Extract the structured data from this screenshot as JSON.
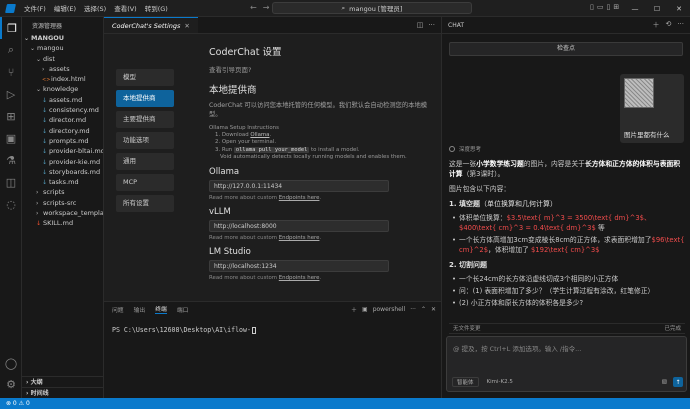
{
  "titlebar": {
    "menu": [
      "文件(F)",
      "编辑(E)",
      "选择(S)",
      "查看(V)",
      "转到(G)"
    ],
    "search_text": "mangou [管理员]"
  },
  "explorer": {
    "header": "资源管理器",
    "root": "MANGOU",
    "items": [
      {
        "label": "mangou",
        "kind": "folder",
        "indent": 1
      },
      {
        "label": "dist",
        "kind": "folder",
        "indent": 2
      },
      {
        "label": "assets",
        "kind": "folder-closed",
        "indent": 3
      },
      {
        "label": "index.html",
        "kind": "html",
        "indent": 3
      },
      {
        "label": "knowledge",
        "kind": "folder",
        "indent": 2
      },
      {
        "label": "assets.md",
        "kind": "md",
        "indent": 3
      },
      {
        "label": "consistency.md",
        "kind": "md",
        "indent": 3
      },
      {
        "label": "director.md",
        "kind": "md",
        "indent": 3
      },
      {
        "label": "directory.md",
        "kind": "md",
        "indent": 3
      },
      {
        "label": "prompts.md",
        "kind": "md",
        "indent": 3
      },
      {
        "label": "provider-bltai.md",
        "kind": "md",
        "indent": 3
      },
      {
        "label": "provider-kie.md",
        "kind": "md",
        "indent": 3
      },
      {
        "label": "storyboards.md",
        "kind": "md",
        "indent": 3
      },
      {
        "label": "tasks.md",
        "kind": "md",
        "indent": 3
      },
      {
        "label": "scripts",
        "kind": "folder-closed",
        "indent": 2
      },
      {
        "label": "scripts-src",
        "kind": "folder-closed",
        "indent": 2
      },
      {
        "label": "workspace_template",
        "kind": "folder-closed",
        "indent": 2
      },
      {
        "label": "SKILL.md",
        "kind": "skill",
        "indent": 2
      }
    ],
    "outline": "大纲",
    "timeline": "时间线"
  },
  "editor": {
    "tab_label": "CoderChat's Settings",
    "nav": [
      "模型",
      "本地提供商",
      "主要提供商",
      "功能选项",
      "通用",
      "MCP",
      "所有设置"
    ],
    "title": "CoderChat 设置",
    "guide_link": "查看引导页面?",
    "section_title": "本地提供商",
    "section_desc": "CoderChat 可以访问您本地托管的任何模型。我们默认会自动检测您的本地模型。",
    "ollama_instructions": {
      "title": "Ollama Setup Instructions",
      "step1_prefix": "1. Download ",
      "step1_link": "Ollama",
      "step1_suffix": ".",
      "step2": "2. Open your terminal.",
      "step3_prefix": "3. Run ",
      "step3_code": "ollama pull your_model",
      "step3_suffix": " to install a model.",
      "note": "Void automatically detects locally running models and enables them."
    },
    "providers": [
      {
        "name": "Ollama",
        "endpoint": "http://127.0.0.1:11434"
      },
      {
        "name": "vLLM",
        "endpoint": "http://localhost:8000"
      },
      {
        "name": "LM Studio",
        "endpoint": "http://localhost:1234"
      }
    ],
    "more_prefix": "Read more about custom ",
    "more_link": "Endpoints here",
    "more_suffix": "."
  },
  "panel": {
    "tabs": [
      "问题",
      "输出",
      "终端",
      "端口"
    ],
    "active_tab": "终端",
    "shell": "powershell",
    "prompt": "PS C:\\Users\\12608\\Desktop\\AI\\iflow-"
  },
  "chat": {
    "header": "CHAT",
    "checkpoint": "检查点",
    "user_message": "图片里都有什么",
    "assistant_head": "深度思考",
    "intro_prefix": "这是一张",
    "intro_bold1": "小学数学练习题",
    "intro_mid": "的图片，内容是关于",
    "intro_bold2": "长方体和正方体的体积与表面积计算",
    "intro_suffix": "（第3课时）。",
    "contains": "图片包含以下内容：",
    "section1_title": "1. 填空题",
    "section1_sub": "（单位换算和几何计算）",
    "s1_item1_prefix": "体积单位换算：",
    "s1_item1_red": "$3.5\\text{ m}^3 = 3500\\text{ dm}^3$、$400\\text{ cm}^3 = 0.4\\text{ dm}^3$",
    "s1_item1_suffix": " 等",
    "s1_item2_prefix": "一个长方体高增加3cm变成棱长8cm的正方体，求表面积增加了",
    "s1_item2_red1": "$96\\text{ cm}^2$",
    "s1_item2_mid": "，体积增加了 ",
    "s1_item2_red2": "$192\\text{ cm}^3$",
    "section2_title": "2. 切割问题",
    "s2_item1": "一个长24cm的长方体沿虚线切成3个相同的小正方体",
    "s2_item2": "问：(1) 表面积增加了多少？（学生计算过程有涂改，红笔修正）",
    "s2_item3": "(2) 小正方体和原长方体的体积各是多少?",
    "pending": "无文件变更",
    "pending_right": "已完成",
    "input_placeholder": "@ 提及，按 Ctrl+L 添加选项。输入 /指令...",
    "mode": "智能体",
    "model": "Kimi-K2.5"
  },
  "statusbar": {
    "left": "⊗ 0 ⚠ 0"
  }
}
